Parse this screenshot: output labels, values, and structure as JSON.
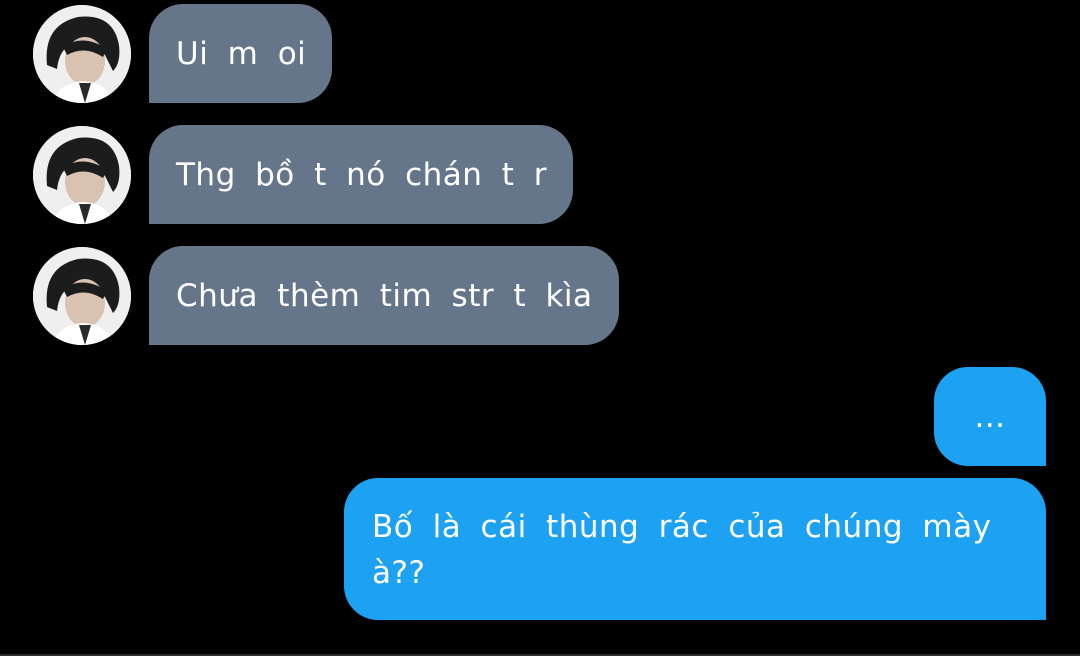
{
  "messages": [
    {
      "sender": "other",
      "text": "Ui m oi"
    },
    {
      "sender": "other",
      "text": "Thg bồ t nó chán t r"
    },
    {
      "sender": "other",
      "text": "Chưa thèm tim str t kìa"
    },
    {
      "sender": "self",
      "text": "..."
    },
    {
      "sender": "self",
      "text_line_1": "Bố là cái thùng rác của chúng mày",
      "text_line_2": "à??"
    }
  ],
  "colors": {
    "background": "#000000",
    "incoming_bubble": "#66768a",
    "outgoing_bubble": "#1da1f2",
    "text": "#ffffff"
  },
  "icons": {
    "avatar": "profile-photo-avatar"
  }
}
